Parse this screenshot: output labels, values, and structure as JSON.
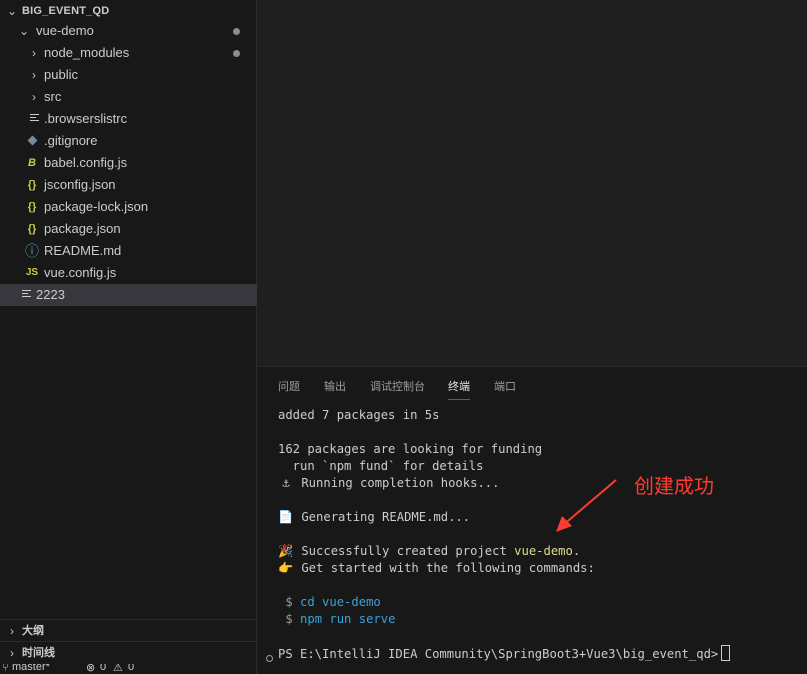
{
  "explorer": {
    "root": "BIG_EVENT_QD",
    "items": [
      {
        "label": "vue-demo",
        "type": "folder-open",
        "modified": true
      },
      {
        "label": "node_modules",
        "type": "folder",
        "modified": true
      },
      {
        "label": "public",
        "type": "folder"
      },
      {
        "label": "src",
        "type": "folder"
      },
      {
        "label": ".browserslistrc",
        "type": "text-lines-icon"
      },
      {
        "label": ".gitignore",
        "type": "git-icon"
      },
      {
        "label": "babel.config.js",
        "type": "babel-icon",
        "icon_text": "B"
      },
      {
        "label": "jsconfig.json",
        "type": "json-icon",
        "icon_text": "{}"
      },
      {
        "label": "package-lock.json",
        "type": "json-icon",
        "icon_text": "{}"
      },
      {
        "label": "package.json",
        "type": "json-icon",
        "icon_text": "{}"
      },
      {
        "label": "README.md",
        "type": "info-icon"
      },
      {
        "label": "vue.config.js",
        "type": "js-icon",
        "icon_text": "JS"
      },
      {
        "label": "2223",
        "type": "text-lines-icon",
        "selected": true
      }
    ],
    "outline_label": "大纲",
    "timeline_label": "时间线"
  },
  "panel": {
    "tabs": [
      "问题",
      "输出",
      "调试控制台",
      "终端",
      "端口"
    ],
    "active_tab": "终端",
    "terminal": {
      "line1": "added 7 packages in 5s",
      "line2": "162 packages are looking for funding",
      "line3": "  run `npm fund` for details",
      "line4_icon": "⚓",
      "line4": "Running completion hooks...",
      "line5_icon": "📄",
      "line5": "Generating README.md...",
      "line6_icon": "🎉",
      "line6_pre": "Successfully created project ",
      "line6_project": "vue-demo",
      "line6_post": ".",
      "line7_icon": "👉",
      "line7": "Get started with the following commands:",
      "cmd1": "cd vue-demo",
      "cmd2": "npm run serve",
      "dollar": "$",
      "prompt": "PS E:\\IntelliJ IDEA Community\\SpringBoot3+Vue3\\big_event_qd>"
    }
  },
  "annotation": {
    "text": "创建成功",
    "color": "#ff3b30"
  },
  "statusbar": {
    "branch": "master*",
    "errors": "0",
    "warnings": "0"
  },
  "colors": {
    "sidebar_bg": "#181818",
    "editor_bg": "#1f1f1f",
    "selection": "#37373d",
    "accent": "#0078d4",
    "json_icon": "#cbcb41",
    "js_icon": "#cbcb41",
    "command_text": "#3ba3d9",
    "project_name": "#dcdc8b"
  }
}
